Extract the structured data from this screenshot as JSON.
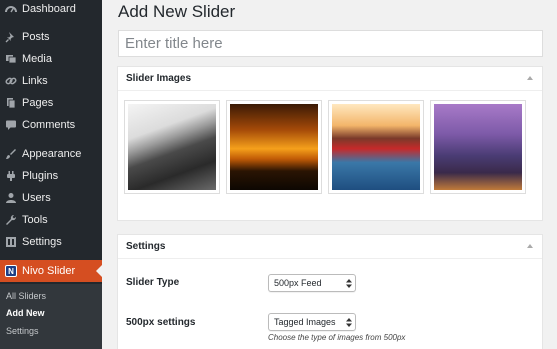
{
  "sidebar": {
    "menu": [
      {
        "label": "Dashboard",
        "icon": "dashboard-icon"
      },
      {
        "label": "Posts",
        "icon": "pushpin-icon"
      },
      {
        "label": "Media",
        "icon": "media-icon"
      },
      {
        "label": "Links",
        "icon": "link-icon"
      },
      {
        "label": "Pages",
        "icon": "pages-icon"
      },
      {
        "label": "Comments",
        "icon": "comment-icon"
      },
      {
        "label": "Appearance",
        "icon": "paintbrush-icon"
      },
      {
        "label": "Plugins",
        "icon": "plugin-icon"
      },
      {
        "label": "Users",
        "icon": "user-icon"
      },
      {
        "label": "Tools",
        "icon": "wrench-icon"
      },
      {
        "label": "Settings",
        "icon": "settings-icon"
      },
      {
        "label": "Nivo Slider",
        "icon": "nivo-icon",
        "badge": "N"
      }
    ],
    "submenu": [
      {
        "label": "All Sliders"
      },
      {
        "label": "Add New"
      },
      {
        "label": "Settings"
      }
    ]
  },
  "page": {
    "title": "Add New Slider",
    "title_placeholder": "Enter title here",
    "title_value": ""
  },
  "slider_images_box": {
    "title": "Slider Images",
    "images": [
      {
        "name": "coastal-road-bw"
      },
      {
        "name": "orange-sunset-city"
      },
      {
        "name": "water-reflection-sunset"
      },
      {
        "name": "taipei-101-night"
      }
    ]
  },
  "settings_box": {
    "title": "Settings",
    "slider_type_label": "Slider Type",
    "slider_type_value": "500px Feed",
    "settings_label": "500px settings",
    "settings_value": "Tagged Images",
    "help": "Choose the type of images from 500px"
  },
  "colors": {
    "sidebar_bg": "#23282d",
    "submenu_bg": "#32373c",
    "active_menu": "#d54e21",
    "page_bg": "#f1f1f1"
  }
}
